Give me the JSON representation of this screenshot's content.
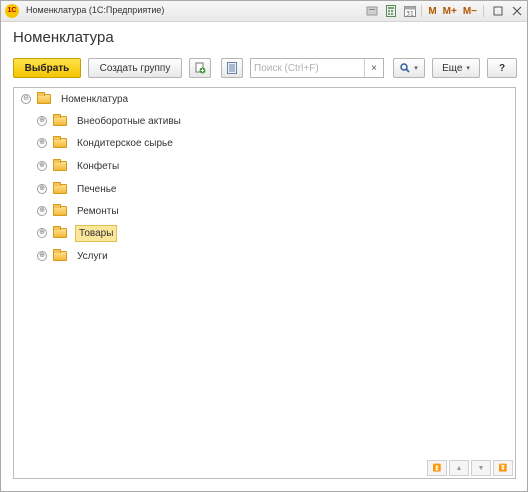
{
  "window": {
    "title": "Номенклатура  (1С:Предприятие)",
    "logo_text": "1С"
  },
  "titlebar_icons": [
    "document-icon",
    "calculator-icon",
    "calendar-icon"
  ],
  "titlebar_memory": [
    "M",
    "M+",
    "M−"
  ],
  "page": {
    "title": "Номенклатура"
  },
  "toolbar": {
    "select_label": "Выбрать",
    "create_group_label": "Создать группу",
    "search_placeholder": "Поиск (Ctrl+F)",
    "clear_label": "×",
    "more_label": "Еще",
    "help_label": "?"
  },
  "tree": {
    "root": {
      "label": "Номенклатура",
      "expander": "⊖"
    },
    "items": [
      {
        "label": "Внеоборотные активы",
        "expander": "⊕"
      },
      {
        "label": "Кондитерское сырье",
        "expander": "⊕"
      },
      {
        "label": "Конфеты",
        "expander": "⊕"
      },
      {
        "label": "Печенье",
        "expander": "⊕"
      },
      {
        "label": "Ремонты",
        "expander": "⊕"
      },
      {
        "label": "Товары",
        "expander": "⊕",
        "selected": true
      },
      {
        "label": "Услуги",
        "expander": "⊕"
      }
    ]
  },
  "colors": {
    "accent": "#f4c400",
    "selection": "#fbe79a"
  }
}
